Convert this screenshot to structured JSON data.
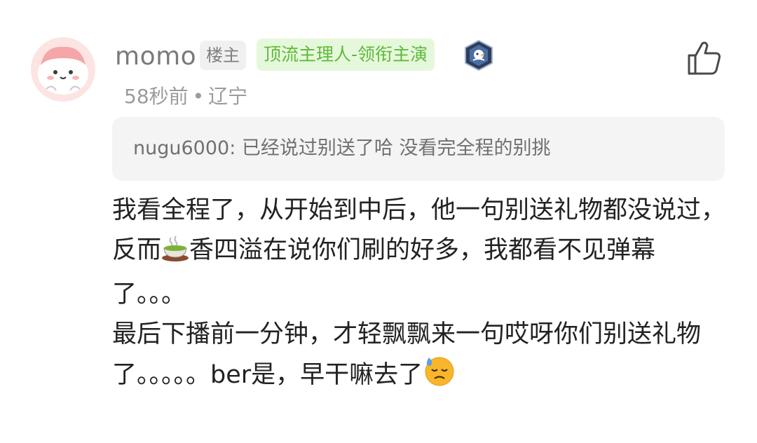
{
  "comment": {
    "username": "momo",
    "host_badge": "楼主",
    "title_badge": "顶流主理人-领衔主演",
    "time": "58秒前",
    "separator": "•",
    "location": "辽宁",
    "avatar_icon": "pink-cartoon-avatar",
    "level_icon": "level-badge-icon",
    "like_icon": "thumbs-up-icon",
    "quoted": {
      "text": "nugu6000: 已经说过别送了哈 没看完全程的别挑"
    },
    "body": {
      "p1_a": "我看全程了，从开始到中后，他一句别送礼物都没说过，反而",
      "p1_b": "香四溢在说你们刷的好多，我都看不见弹幕了。。。",
      "p2_a": "最后下播前一分钟，才轻飘飘来一句哎呀你们别送礼物了。。。。。ber是，早干嘛去了"
    },
    "colors": {
      "title_badge_bg": "#e6f8dc",
      "title_badge_fg": "#5fb93b",
      "host_badge_bg": "#f0f0f0"
    }
  }
}
